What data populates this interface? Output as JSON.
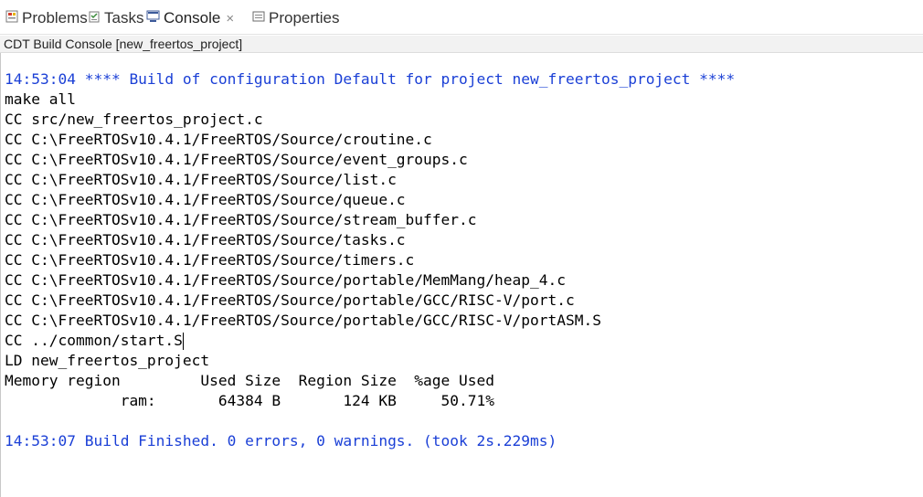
{
  "tabs": [
    {
      "label": "Problems",
      "icon": "problems-icon"
    },
    {
      "label": "Tasks",
      "icon": "tasks-icon"
    },
    {
      "label": "Console",
      "icon": "console-icon",
      "active": true
    },
    {
      "label": "Properties",
      "icon": "properties-icon"
    }
  ],
  "console_title": "CDT Build Console [new_freertos_project]",
  "lines": [
    "14:53:04 **** Build of configuration Default for project new_freertos_project ****",
    "make all",
    "CC src/new_freertos_project.c",
    "CC C:\\FreeRTOSv10.4.1/FreeRTOS/Source/croutine.c",
    "CC C:\\FreeRTOSv10.4.1/FreeRTOS/Source/event_groups.c",
    "CC C:\\FreeRTOSv10.4.1/FreeRTOS/Source/list.c",
    "CC C:\\FreeRTOSv10.4.1/FreeRTOS/Source/queue.c",
    "CC C:\\FreeRTOSv10.4.1/FreeRTOS/Source/stream_buffer.c",
    "CC C:\\FreeRTOSv10.4.1/FreeRTOS/Source/tasks.c",
    "CC C:\\FreeRTOSv10.4.1/FreeRTOS/Source/timers.c",
    "CC C:\\FreeRTOSv10.4.1/FreeRTOS/Source/portable/MemMang/heap_4.c",
    "CC C:\\FreeRTOSv10.4.1/FreeRTOS/Source/portable/GCC/RISC-V/port.c",
    "CC C:\\FreeRTOSv10.4.1/FreeRTOS/Source/portable/GCC/RISC-V/portASM.S",
    "CC ../common/start.S",
    "LD new_freertos_project",
    "Memory region         Used Size  Region Size  %age Used",
    "             ram:       64384 B       124 KB     50.71%",
    "",
    "14:53:07 Build Finished. 0 errors, 0 warnings. (took 2s.229ms)"
  ],
  "colors": {
    "info_text": "#1a3fd6",
    "output_text": "#000000"
  }
}
